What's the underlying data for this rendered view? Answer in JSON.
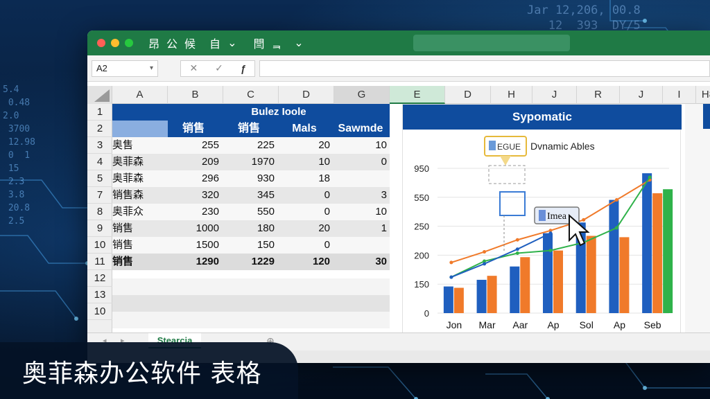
{
  "background_code": {
    "top_right": "Jar 12,206, 00.8\n   12  393  DY/5",
    "left": "5.4\n 0.48\n2.0\n 3700\n 12.98\n 0  1\n 15\n 2.3\n 3.8\n 20.8\n 2.5"
  },
  "titlebar": {
    "icons": [
      "昂",
      "公",
      "候",
      "自",
      "⌄",
      "閆",
      "ᆿ",
      "⌄"
    ],
    "color": "#1f7a45"
  },
  "formula_bar": {
    "name_box": "A2",
    "name_box_arrow": "▾",
    "cancel_glyph": "✕",
    "confirm_glyph": "✓",
    "fx_glyph": "ƒ"
  },
  "columns": [
    "A",
    "B",
    "C",
    "D",
    "G",
    "E",
    "D",
    "H",
    "J",
    "R",
    "J",
    "I",
    "H8"
  ],
  "rows": [
    "1",
    "2",
    "3",
    "4",
    "5",
    "7",
    "8",
    "9",
    "10",
    "11",
    "12",
    "13",
    "10"
  ],
  "table": {
    "title": "Bulez Ioole",
    "headers": [
      "",
      "销售",
      "销售",
      "Mals",
      "Sawmde"
    ],
    "data": [
      [
        "奥售",
        "255",
        "225",
        "20",
        "10"
      ],
      [
        "奥菲森",
        "209",
        "1970",
        "10",
        "0"
      ],
      [
        "奥菲森",
        "296",
        "930",
        "18",
        ""
      ],
      [
        "销售森",
        "320",
        "345",
        "0",
        "3"
      ],
      [
        "奥菲众",
        "230",
        "550",
        "0",
        "10"
      ],
      [
        "销售",
        "1000",
        "180",
        "20",
        "1"
      ],
      [
        "销售",
        "1500",
        "150",
        "0",
        ""
      ],
      [
        "销售",
        "1290",
        "1229",
        "120",
        "30"
      ]
    ]
  },
  "chart": {
    "panel_title": "Sypomatic",
    "legend_text": "Dvnamic Ables",
    "legend_box_label": "EGUE",
    "tooltip_label": "Imea",
    "accent": "#0f4c9e"
  },
  "chart_data": {
    "type": "bar",
    "title": "Sypomatic",
    "categories": [
      "Jon",
      "Mar",
      "Aar",
      "Ap",
      "Sol",
      "Ap",
      "Seb"
    ],
    "y_tick_labels": [
      "0",
      "150",
      "200",
      "250",
      "550",
      "950"
    ],
    "series": [
      {
        "values": [
          0.2,
          0.25,
          0.35,
          0.6,
          0.68,
          0.85,
          1.05
        ],
        "color": "#1f5fbf"
      },
      {
        "values": [
          0.19,
          0.28,
          0.42,
          0.47,
          0.58,
          0.57,
          0.9
        ],
        "color": "#f07a2a"
      },
      {
        "values": [
          null,
          null,
          null,
          null,
          null,
          null,
          0.93
        ],
        "color": "#2fb24a"
      }
    ],
    "lines": [
      {
        "values": [
          0.38,
          0.46,
          0.55,
          0.62,
          0.7,
          0.85,
          1.0
        ],
        "color": "#f07a2a"
      },
      {
        "values": [
          0.27,
          0.39,
          0.45,
          0.47,
          0.53,
          0.64,
          1.02
        ],
        "color": "#2fb24a"
      },
      {
        "values": [
          0.27,
          0.37,
          0.48,
          0.6
        ],
        "color": "#1f5fbf"
      }
    ]
  },
  "sheet_tab": "Stearcia",
  "caption": "奥菲森办公软件 表格"
}
